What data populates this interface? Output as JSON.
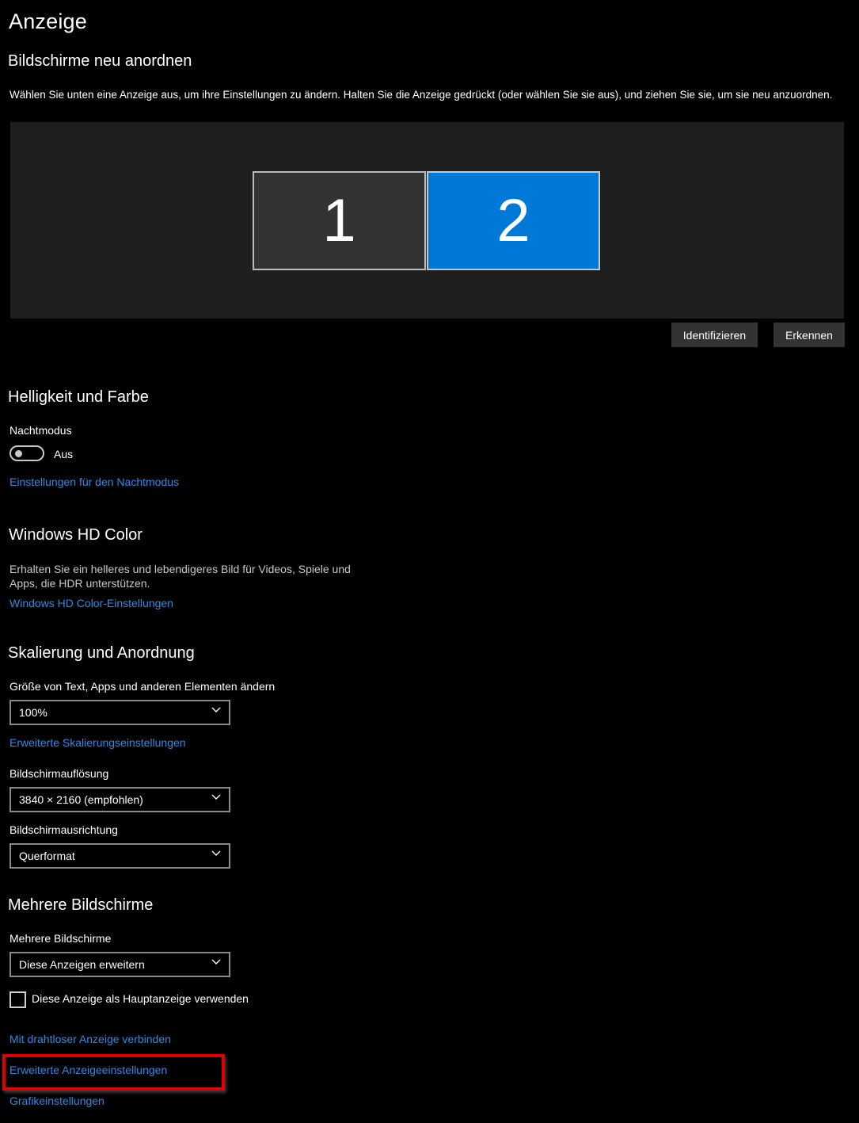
{
  "page": {
    "title": "Anzeige"
  },
  "arrange": {
    "heading": "Bildschirme neu anordnen",
    "description": "Wählen Sie unten eine Anzeige aus, um ihre Einstellungen zu ändern. Halten Sie die Anzeige gedrückt (oder wählen Sie sie aus), und ziehen Sie sie, um sie neu anzuordnen.",
    "monitors": [
      {
        "number": "1",
        "selected": false
      },
      {
        "number": "2",
        "selected": true
      }
    ],
    "identify_label": "Identifizieren",
    "detect_label": "Erkennen"
  },
  "brightness": {
    "heading": "Helligkeit und Farbe",
    "night_mode_label": "Nachtmodus",
    "night_mode_state": "Aus",
    "night_mode_link": "Einstellungen für den Nachtmodus"
  },
  "hdr": {
    "heading": "Windows HD Color",
    "description_line1": "Erhalten Sie ein helleres und lebendigeres Bild für Videos, Spiele und",
    "description_line2": "Apps, die HDR unterstützen.",
    "link": "Windows HD Color-Einstellungen"
  },
  "scaling": {
    "heading": "Skalierung und Anordnung",
    "size_label": "Größe von Text, Apps und anderen Elementen ändern",
    "size_value": "100%",
    "advanced_scaling_link": "Erweiterte Skalierungseinstellungen",
    "resolution_label": "Bildschirmauflösung",
    "resolution_value": "3840 × 2160 (empfohlen)",
    "orientation_label": "Bildschirmausrichtung",
    "orientation_value": "Querformat"
  },
  "multi": {
    "heading": "Mehrere Bildschirme",
    "label": "Mehrere Bildschirme",
    "value": "Diese Anzeigen erweitern",
    "main_display_checkbox": "Diese Anzeige als Hauptanzeige verwenden",
    "main_display_checked": false,
    "wireless_link": "Mit drahtloser Anzeige verbinden",
    "advanced_display_link": "Erweiterte Anzeigeeinstellungen",
    "graphics_link": "Grafikeinstellungen"
  },
  "colors": {
    "background": "#000000",
    "accent": "#0078d7",
    "link": "#2f8ae6",
    "highlight": "#e00000"
  }
}
